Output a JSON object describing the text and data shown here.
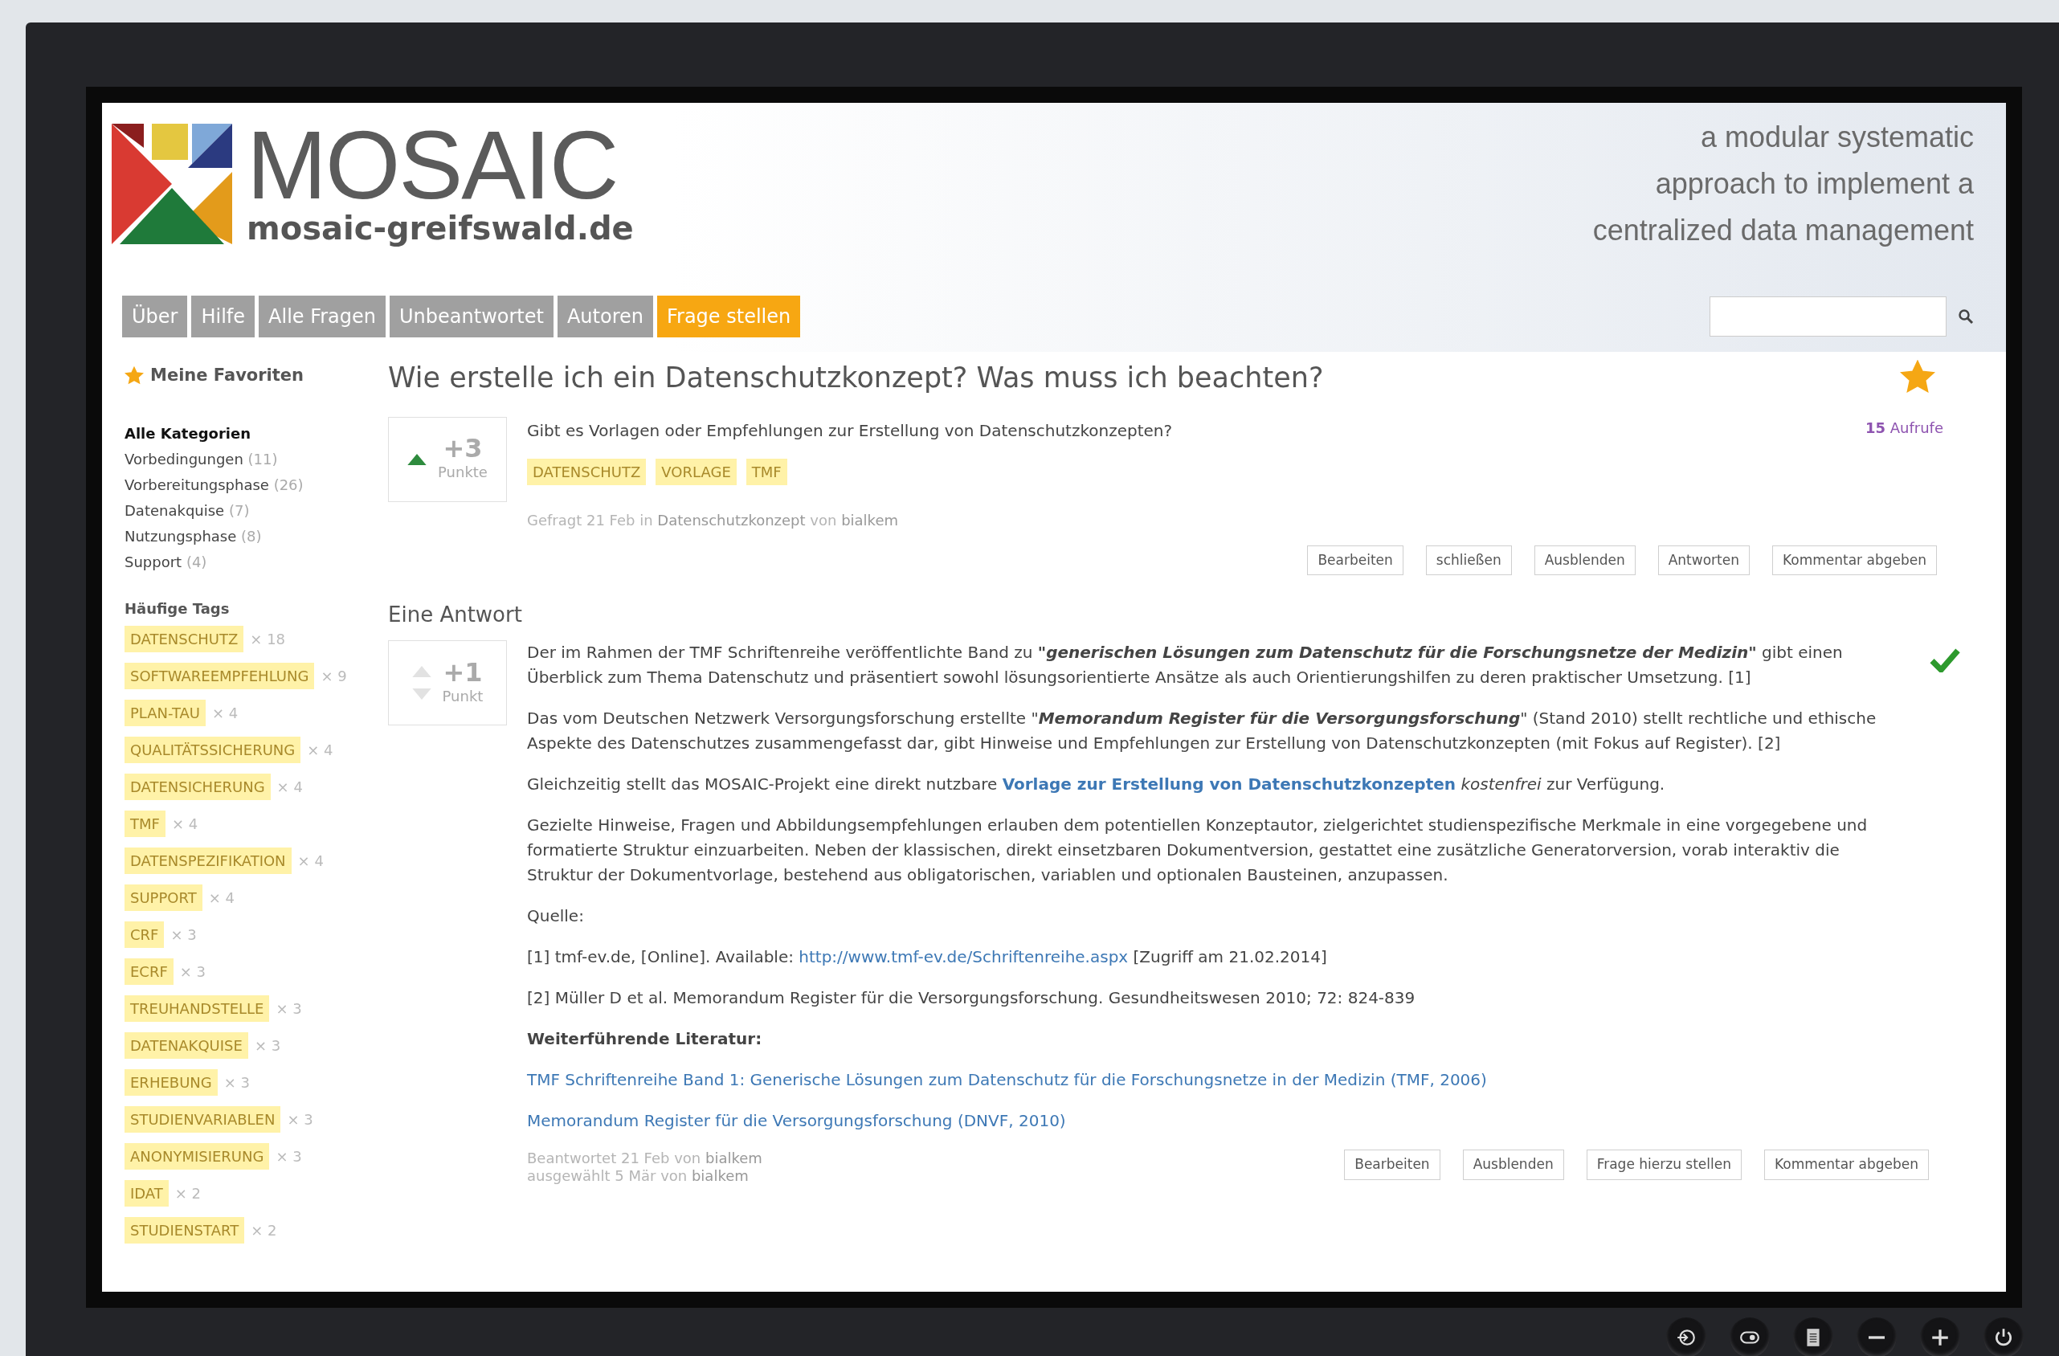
{
  "header": {
    "logo_text": "MOSAIC",
    "site": "mosaic-greifswald.de",
    "tagline": [
      "a modular systematic",
      "approach to implement a",
      "centralized data management"
    ]
  },
  "nav": [
    {
      "label": "Über",
      "highlighted": false
    },
    {
      "label": "Hilfe",
      "highlighted": false
    },
    {
      "label": "Alle Fragen",
      "highlighted": false
    },
    {
      "label": "Unbeantwortet",
      "highlighted": false
    },
    {
      "label": "Autoren",
      "highlighted": false
    },
    {
      "label": "Frage stellen",
      "highlighted": true
    }
  ],
  "sidebar": {
    "favorites": "Meine Favoriten",
    "categories_title": "Alle Kategorien",
    "categories": [
      {
        "name": "Vorbedingungen",
        "count": "(11)"
      },
      {
        "name": "Vorbereitungsphase",
        "count": "(26)"
      },
      {
        "name": "Datenakquise",
        "count": "(7)"
      },
      {
        "name": "Nutzungsphase",
        "count": "(8)"
      },
      {
        "name": "Support",
        "count": "(4)"
      }
    ],
    "tags_title": "Häufige Tags",
    "tags": [
      {
        "label": "DATENSCHUTZ",
        "count": "× 18"
      },
      {
        "label": "SOFTWAREEMPFEHLUNG",
        "count": "× 9"
      },
      {
        "label": "PLAN-TAU",
        "count": "× 4"
      },
      {
        "label": "QUALITÄTSSICHERUNG",
        "count": "× 4"
      },
      {
        "label": "DATENSICHERUNG",
        "count": "× 4"
      },
      {
        "label": "TMF",
        "count": "× 4"
      },
      {
        "label": "DATENSPEZIFIKATION",
        "count": "× 4"
      },
      {
        "label": "SUPPORT",
        "count": "× 4"
      },
      {
        "label": "CRF",
        "count": "× 3"
      },
      {
        "label": "ECRF",
        "count": "× 3"
      },
      {
        "label": "TREUHANDSTELLE",
        "count": "× 3"
      },
      {
        "label": "DATENAKQUISE",
        "count": "× 3"
      },
      {
        "label": "ERHEBUNG",
        "count": "× 3"
      },
      {
        "label": "STUDIENVARIABLEN",
        "count": "× 3"
      },
      {
        "label": "ANONYMISIERUNG",
        "count": "× 3"
      },
      {
        "label": "IDAT",
        "count": "× 2"
      },
      {
        "label": "STUDIENSTART",
        "count": "× 2"
      }
    ]
  },
  "question": {
    "title": "Wie erstelle ich ein Datenschutzkonzept? Was muss ich beachten?",
    "favorite": true,
    "vote": {
      "score": "+3",
      "unit": "Punkte",
      "voted": true,
      "down_arrow": false
    },
    "text": "Gibt es Vorlagen oder Empfehlungen zur Erstellung von Datenschutzkonzepten?",
    "views_count": "15",
    "views_label": "Aufrufe",
    "tags": [
      "DATENSCHUTZ",
      "VORLAGE",
      "TMF"
    ],
    "meta": [
      {
        "text": "Gefragt 21 Feb",
        "emphasis": false
      },
      {
        "text": " in ",
        "emphasis": false
      },
      {
        "text": "Datenschutzkonzept",
        "emphasis": true
      },
      {
        "text": " von ",
        "emphasis": false
      },
      {
        "text": "bialkem",
        "emphasis": true
      }
    ],
    "buttons": [
      "Bearbeiten",
      "schließen",
      "Ausblenden",
      "Antworten",
      "Kommentar abgeben"
    ]
  },
  "answers_title": "Eine Antwort",
  "answer": {
    "vote": {
      "score": "+1",
      "unit": "Punkt",
      "voted": false,
      "down_arrow": true
    },
    "accepted": true,
    "paragraphs": [
      [
        {
          "kind": "plain",
          "text": "Der im Rahmen der TMF Schriftenreihe veröffentlichte Band zu "
        },
        {
          "kind": "bolditalic",
          "text": "\"generischen Lösungen zum Datenschutz für die Forschungsnetze der Medizin\""
        },
        {
          "kind": "plain",
          "text": " gibt einen Überblick zum Thema Datenschutz und präsentiert sowohl lösungsorientierte Ansätze als auch Orientierungshilfen zu deren praktischer Umsetzung. [1]"
        }
      ],
      [
        {
          "kind": "plain",
          "text": "Das vom Deutschen Netzwerk Versorgungsforschung erstellte \""
        },
        {
          "kind": "bolditalic",
          "text": "Memorandum Register für die Versorgungsforschung"
        },
        {
          "kind": "plain",
          "text": "\" (Stand 2010) stellt rechtliche und ethische Aspekte des Datenschutzes zusammengefasst dar, gibt Hinweise und Empfehlungen zur Erstellung von Datenschutzkonzepten (mit Fokus auf Register). [2]"
        }
      ],
      [
        {
          "kind": "plain",
          "text": "Gleichzeitig stellt das MOSAIC-Projekt eine direkt nutzbare "
        },
        {
          "kind": "boldlink",
          "text": "Vorlage zur Erstellung von Datenschutzkonzepten"
        },
        {
          "kind": "italic",
          "text": " kostenfrei"
        },
        {
          "kind": "plain",
          "text": " zur Verfügung."
        }
      ],
      [
        {
          "kind": "plain",
          "text": "Gezielte Hinweise, Fragen und Abbildungsempfehlungen erlauben dem potentiellen Konzeptautor, zielgerichtet studienspezifische Merkmale in eine vorgegebene und formatierte Struktur einzuarbeiten. Neben der klassischen, direkt einsetzbaren Dokumentversion, gestattet eine zusätzliche Generatorversion, vorab interaktiv die Struktur der Dokumentvorlage, bestehend aus obligatorischen, variablen und optionalen Bausteinen, anzupassen."
        }
      ],
      [
        {
          "kind": "plain",
          "text": "Quelle:"
        }
      ],
      [
        {
          "kind": "plain",
          "text": "[1] tmf-ev.de, [Online]. Available: "
        },
        {
          "kind": "link",
          "text": "http://www.tmf-ev.de/Schriftenreihe.aspx"
        },
        {
          "kind": "plain",
          "text": " [Zugriff am 21.02.2014]"
        }
      ],
      [
        {
          "kind": "plain",
          "text": "[2] Müller D et al. Memorandum Register für die Versorgungsforschung. Gesundheitswesen 2010; 72: 824-839"
        }
      ],
      [
        {
          "kind": "bold",
          "text": "Weiterführende Literatur:"
        }
      ],
      [
        {
          "kind": "link",
          "text": "TMF Schriftenreihe Band 1: Generische Lösungen zum Datenschutz für die Forschungsnetze in der Medizin (TMF, 2006)"
        }
      ],
      [
        {
          "kind": "link",
          "text": "Memorandum Register für die Versorgungsforschung (DNVF, 2010)"
        }
      ]
    ],
    "meta": [
      [
        {
          "text": "Beantwortet 21 Feb",
          "emphasis": false
        },
        {
          "text": " von ",
          "emphasis": false
        },
        {
          "text": "bialkem",
          "emphasis": true
        }
      ],
      [
        {
          "text": "ausgewählt 5 Mär",
          "emphasis": false
        },
        {
          "text": " von ",
          "emphasis": false
        },
        {
          "text": "bialkem",
          "emphasis": true
        }
      ]
    ],
    "buttons": [
      "Bearbeiten",
      "Ausblenden",
      "Frage hierzu stellen",
      "Kommentar abgeben"
    ]
  }
}
